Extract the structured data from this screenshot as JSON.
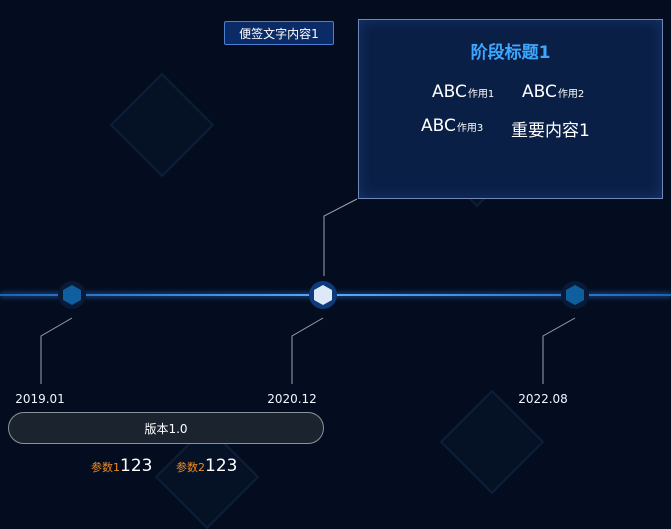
{
  "sticky_note": {
    "label": "便签文字内容1"
  },
  "stage_card": {
    "title": "阶段标题1",
    "metrics": [
      {
        "main": "ABC",
        "sub": "作用1"
      },
      {
        "main": "ABC",
        "sub": "作用2"
      },
      {
        "main": "ABC",
        "sub": "作用3"
      },
      {
        "main": "重要内容1",
        "sub": ""
      }
    ]
  },
  "milestones": [
    {
      "date": "2019.01",
      "highlight": false
    },
    {
      "date": "2020.12",
      "highlight": true
    },
    {
      "date": "2022.08",
      "highlight": false
    }
  ],
  "version_bar": {
    "label": "版本1.0"
  },
  "params": [
    {
      "label": "参数1",
      "value": "123"
    },
    {
      "label": "参数2",
      "value": "123"
    }
  ],
  "colors": {
    "background": "#030d1f",
    "timeline": "#5aa6ff",
    "node_fill": "#0f5f9e",
    "node_highlight": "#dde9f7",
    "title_accent": "#3da7ff",
    "param_label": "#f08a24"
  }
}
